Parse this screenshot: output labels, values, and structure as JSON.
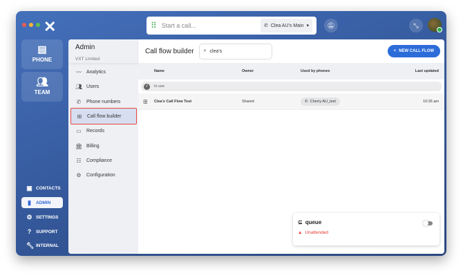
{
  "topbar": {
    "call_placeholder": "Start a call...",
    "line": "Clea AU's Main"
  },
  "rail": {
    "phone": "PHONE",
    "team": "TEAM",
    "nav": [
      "CONTACTS",
      "ADMIN",
      "SETTINGS",
      "SUPPORT",
      "INTERNAL"
    ]
  },
  "admin": {
    "title": "Admin",
    "org": "VXT Limited",
    "items": [
      "Analytics",
      "Users",
      "Phone numbers",
      "Call flow builder",
      "Records",
      "Billing",
      "Compliance",
      "Configuration"
    ]
  },
  "main": {
    "title": "Call flow builder",
    "search_value": "clea's",
    "new_button": "NEW CALL FLOW",
    "columns": [
      "Name",
      "Owner",
      "Used by phones",
      "Last updated"
    ],
    "group": "In use",
    "rows": [
      {
        "name": "Clea's Call Flow Test",
        "owner": "Shared",
        "phone": "Cherry AU_test",
        "updated": "10:26 am"
      }
    ]
  },
  "card": {
    "title": "queue",
    "status": "Unattended"
  },
  "colors": {
    "accent": "#2b6cd9",
    "warning": "#e53935"
  }
}
